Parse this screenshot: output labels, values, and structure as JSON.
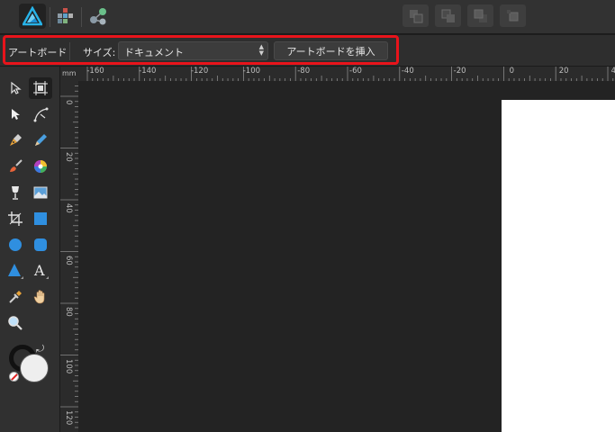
{
  "personas": [
    {
      "name": "designer-persona",
      "active": true
    },
    {
      "name": "pixel-persona",
      "active": false
    },
    {
      "name": "export-persona",
      "active": false
    }
  ],
  "context": {
    "tool_label": "アートボード",
    "size_label": "サイズ:",
    "size_value": "ドキュメント",
    "insert_button": "アートボードを挿入"
  },
  "ruler": {
    "unit": "mm",
    "h_labels": [
      "-160",
      "-140",
      "-120",
      "-100",
      "-80",
      "-60",
      "-40",
      "-20",
      "0",
      "20",
      "40"
    ],
    "v_labels": [
      "0",
      "20",
      "40",
      "60",
      "80",
      "100",
      "120"
    ]
  },
  "fill_color": "#eeeeee",
  "highlight_color": "#e8141b"
}
